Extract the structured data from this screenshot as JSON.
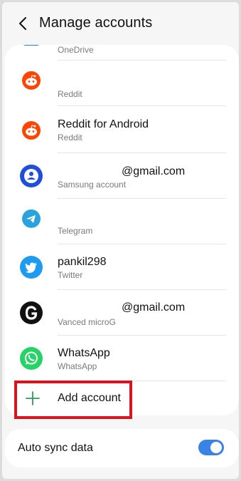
{
  "header": {
    "title": "Manage accounts"
  },
  "accounts": [
    {
      "primary": "",
      "secondary": "OneDrive",
      "icon": "onedrive-icon"
    },
    {
      "primary": "",
      "secondary": "Reddit",
      "icon": "reddit-icon"
    },
    {
      "primary": "Reddit for Android",
      "secondary": "Reddit",
      "icon": "reddit-icon"
    },
    {
      "primary": "@gmail.com",
      "secondary": "Samsung account",
      "icon": "samsung-account-icon"
    },
    {
      "primary": "",
      "secondary": "Telegram",
      "icon": "telegram-icon"
    },
    {
      "primary": "pankil298",
      "secondary": "Twitter",
      "icon": "twitter-icon"
    },
    {
      "primary": "@gmail.com",
      "secondary": "Vanced microG",
      "icon": "vanced-microg-icon"
    },
    {
      "primary": "WhatsApp",
      "secondary": "WhatsApp",
      "icon": "whatsapp-icon"
    }
  ],
  "add_account": {
    "label": "Add account",
    "icon": "plus-icon"
  },
  "auto_sync": {
    "label": "Auto sync data",
    "enabled": true
  },
  "colors": {
    "reddit": "#ff4500",
    "samsung": "#1f4ed8",
    "telegram": "#2aa3dd",
    "twitter": "#1d9bf0",
    "whatsapp": "#25d366",
    "toggle_on": "#3a83e6",
    "highlight": "#d8141e"
  }
}
